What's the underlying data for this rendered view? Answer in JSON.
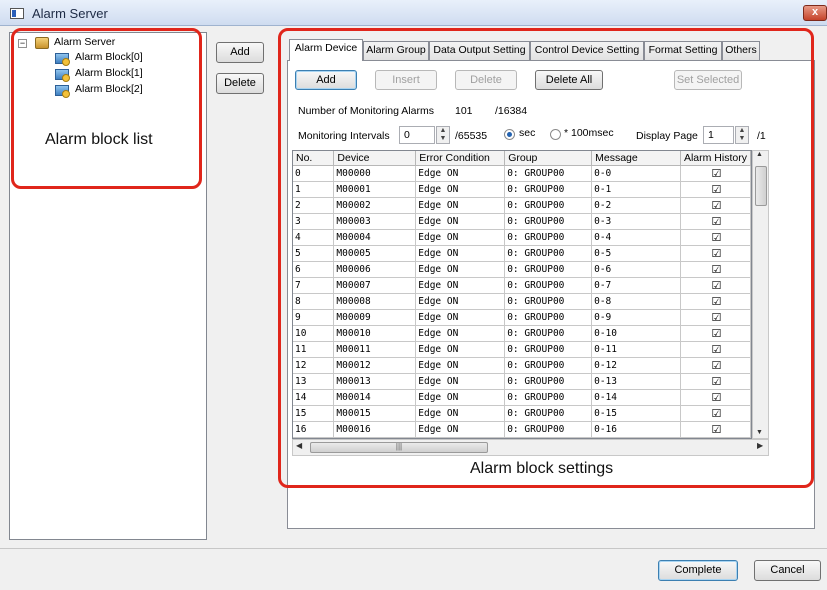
{
  "window": {
    "title": "Alarm Server",
    "close_glyph": "x"
  },
  "tree": {
    "root": "Alarm Server",
    "items": [
      "Alarm Block[0]",
      "Alarm Block[1]",
      "Alarm Block[2]"
    ]
  },
  "side_buttons": {
    "add": "Add",
    "delete": "Delete"
  },
  "tabs": [
    "Alarm Device",
    "Alarm Group",
    "Data Output Setting",
    "Control Device Setting",
    "Format Setting",
    "Others"
  ],
  "toolbar": {
    "add": "Add",
    "insert": "Insert",
    "delete": "Delete",
    "delete_all": "Delete All",
    "set_selected": "Set Selected"
  },
  "monitoring": {
    "count_label": "Number of Monitoring Alarms",
    "count": "101",
    "max": "/16384",
    "interval_label": "Monitoring Intervals",
    "interval_value": "0",
    "interval_max": "/65535",
    "unit_sec": "sec",
    "unit_100ms": "* 100msec",
    "display_page_label": "Display Page",
    "display_page_value": "1",
    "display_page_total": "/1"
  },
  "table": {
    "columns": [
      "No.",
      "Device",
      "Error Condition",
      "Group",
      "Message",
      "Alarm History"
    ],
    "rows": [
      [
        "0",
        "M00000",
        "Edge ON",
        "0: GROUP00",
        "0-0"
      ],
      [
        "1",
        "M00001",
        "Edge ON",
        "0: GROUP00",
        "0-1"
      ],
      [
        "2",
        "M00002",
        "Edge ON",
        "0: GROUP00",
        "0-2"
      ],
      [
        "3",
        "M00003",
        "Edge ON",
        "0: GROUP00",
        "0-3"
      ],
      [
        "4",
        "M00004",
        "Edge ON",
        "0: GROUP00",
        "0-4"
      ],
      [
        "5",
        "M00005",
        "Edge ON",
        "0: GROUP00",
        "0-5"
      ],
      [
        "6",
        "M00006",
        "Edge ON",
        "0: GROUP00",
        "0-6"
      ],
      [
        "7",
        "M00007",
        "Edge ON",
        "0: GROUP00",
        "0-7"
      ],
      [
        "8",
        "M00008",
        "Edge ON",
        "0: GROUP00",
        "0-8"
      ],
      [
        "9",
        "M00009",
        "Edge ON",
        "0: GROUP00",
        "0-9"
      ],
      [
        "10",
        "M00010",
        "Edge ON",
        "0: GROUP00",
        "0-10"
      ],
      [
        "11",
        "M00011",
        "Edge ON",
        "0: GROUP00",
        "0-11"
      ],
      [
        "12",
        "M00012",
        "Edge ON",
        "0: GROUP00",
        "0-12"
      ],
      [
        "13",
        "M00013",
        "Edge ON",
        "0: GROUP00",
        "0-13"
      ],
      [
        "14",
        "M00014",
        "Edge ON",
        "0: GROUP00",
        "0-14"
      ],
      [
        "15",
        "M00015",
        "Edge ON",
        "0: GROUP00",
        "0-15"
      ],
      [
        "16",
        "M00016",
        "Edge ON",
        "0: GROUP00",
        "0-16"
      ]
    ],
    "checked_glyph": "☑"
  },
  "annotations": {
    "block_list": "Alarm block list",
    "block_settings": "Alarm block settings"
  },
  "footer": {
    "complete": "Complete",
    "cancel": "Cancel"
  },
  "colors": {
    "callout": "#e0261b",
    "accent": "#3c7fb1"
  }
}
